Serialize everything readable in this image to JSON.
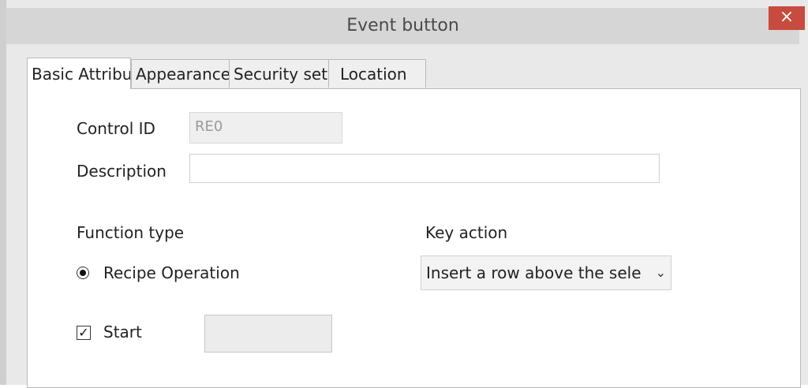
{
  "window": {
    "title": "Event button",
    "close_label": "×"
  },
  "tabs": [
    {
      "label": "Basic Attribu"
    },
    {
      "label": "Appearance"
    },
    {
      "label": "Security set"
    },
    {
      "label": "Location"
    }
  ],
  "form": {
    "control_id_label": "Control ID",
    "control_id_value": "RE0",
    "description_label": "Description",
    "description_value": "",
    "function_type_label": "Function type",
    "function_type_option": "Recipe Operation",
    "key_action_label": "Key action",
    "key_action_value": "Insert a row above the sele",
    "start_label": "Start",
    "start_checked": true,
    "start_checkmark": "✓"
  },
  "icons": {
    "close": "close-icon",
    "chevron": "chevron-down-icon"
  }
}
